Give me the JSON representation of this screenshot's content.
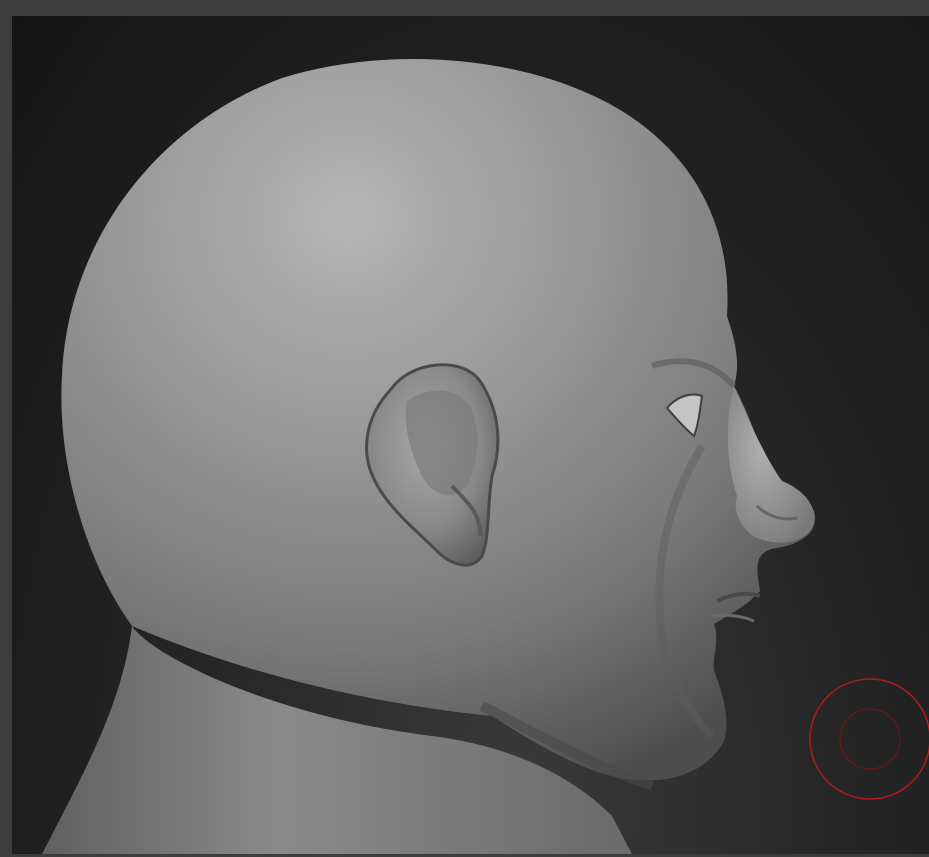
{
  "window": {
    "title": ""
  },
  "viewport": {
    "model_name": "sculpted-head-side-view",
    "background_color": "#1a1a1a",
    "material_color": "#8f8f8f",
    "brush_cursor_color": "#b11a1a"
  },
  "icons": {
    "brush": "brush-cursor-icon"
  }
}
